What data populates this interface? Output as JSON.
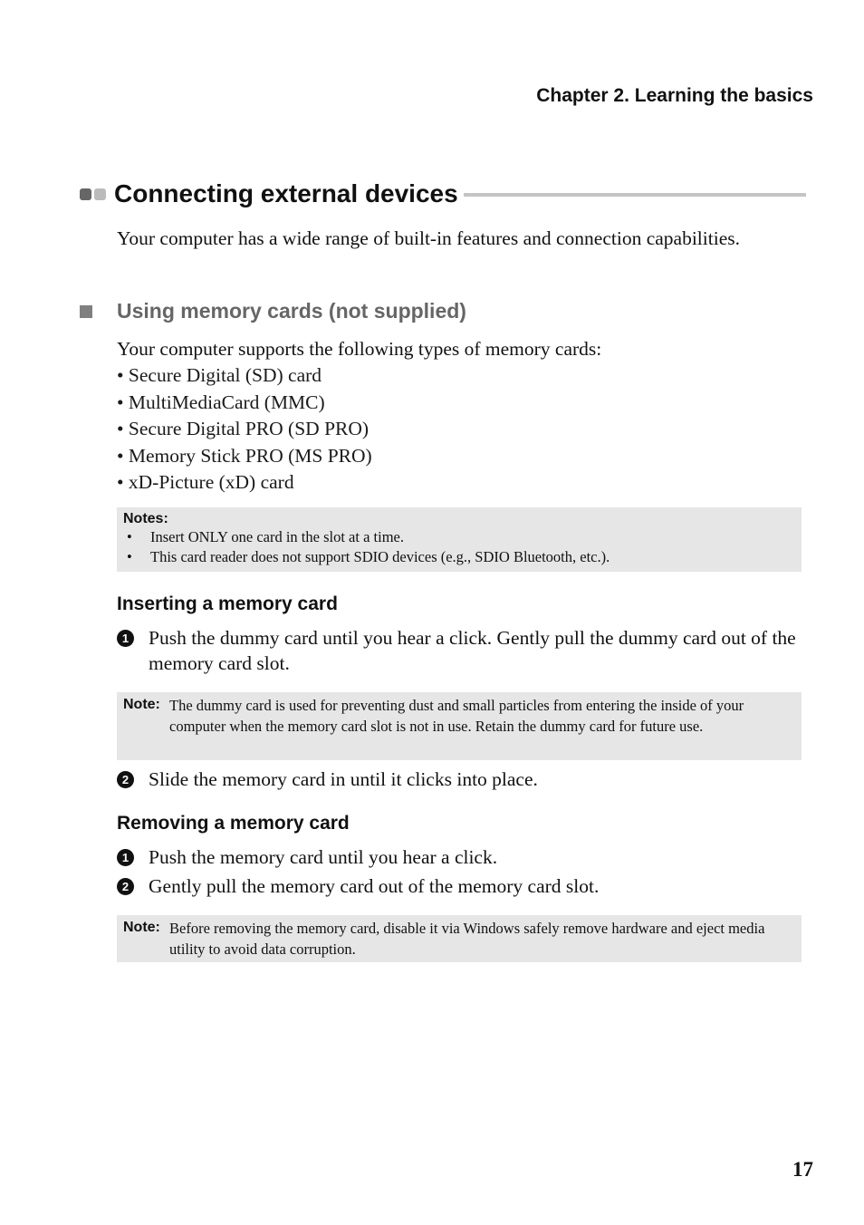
{
  "header": {
    "chapter": "Chapter 2. Learning the basics"
  },
  "section": {
    "title": "Connecting external devices",
    "intro": "Your computer has a wide range of built-in features and connection capabilities."
  },
  "subsection": {
    "title": "Using memory cards (not supplied)",
    "lead": "Your computer supports the following types of memory cards:",
    "cards": [
      "• Secure Digital (SD) card",
      "• MultiMediaCard (MMC)",
      "• Secure Digital PRO (SD PRO)",
      "• Memory Stick PRO (MS PRO)",
      "• xD-Picture (xD) card"
    ],
    "notes": {
      "label": "Notes:",
      "items": [
        "Insert ONLY one card in the slot at a time.",
        "This card reader does not support SDIO devices (e.g., SDIO Bluetooth, etc.)."
      ]
    }
  },
  "inserting": {
    "title": "Inserting a memory card",
    "steps": [
      {
        "num": "1",
        "text": "Push the dummy card until you hear a click. Gently pull the dummy card out of the memory card slot."
      },
      {
        "num": "2",
        "text": "Slide the memory card in until it clicks into place."
      }
    ],
    "note": {
      "label": "Note:",
      "text": "The dummy card is used for preventing dust and small particles from entering the inside of your computer when the memory card slot is not in use. Retain the dummy card for future use."
    }
  },
  "removing": {
    "title": "Removing a memory card",
    "steps": [
      {
        "num": "1",
        "text": "Push the memory card until you hear a click."
      },
      {
        "num": "2",
        "text": "Gently pull the memory card out of the memory card slot."
      }
    ],
    "note": {
      "label": "Note:",
      "text": "Before removing the memory card, disable it via Windows safely remove hardware and eject media utility to avoid data corruption."
    }
  },
  "footer": {
    "page_number": "17"
  }
}
